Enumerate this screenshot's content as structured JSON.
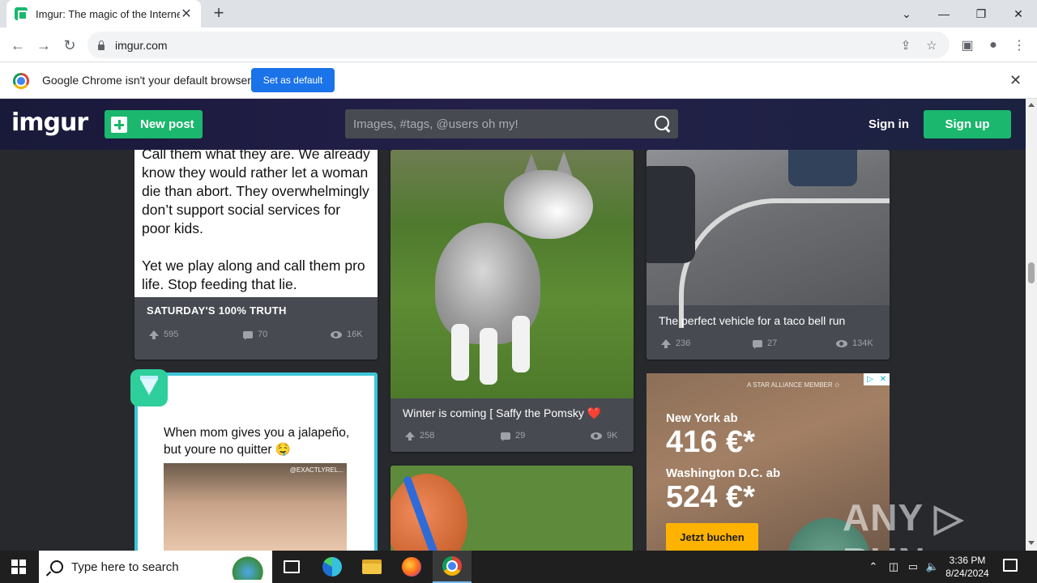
{
  "browser": {
    "tab": {
      "title": "Imgur: The magic of the Internet",
      "close": "✕"
    },
    "new_tab": "+",
    "window_controls": {
      "minimize": "—",
      "restore": "❐",
      "close": "✕",
      "menu": "⌄"
    },
    "address": "imgur.com",
    "infobar": {
      "message": "Google Chrome isn't your default browser",
      "button": "Set as default",
      "close": "✕"
    }
  },
  "imgur": {
    "logo": "imgur",
    "new_post": "New post",
    "search_placeholder": "Images, #tags, @users oh my!",
    "sign_in": "Sign in",
    "sign_up": "Sign up",
    "posts": [
      {
        "image_text": [
          "Call them what they are. We already know they would rather let a woman die than abort. They overwhelmingly don’t support social services for poor kids.",
          "Yet we play along and call them pro life. Stop feeding that lie."
        ],
        "title": "SATURDAY'S 100% TRUTH",
        "upvotes": "595",
        "comments": "70",
        "views": "16K"
      },
      {
        "title": "Winter is coming [ Saffy the Pomsky ❤️",
        "upvotes": "258",
        "comments": "29",
        "views": "9K"
      },
      {
        "title": "The perfect vehicle for a taco bell run",
        "upvotes": "236",
        "comments": "27",
        "views": "134K"
      },
      {
        "image_text": "When mom gives you a jalapeño, but youre no quitter 🤤",
        "credit": "@EXACTLYREL..."
      }
    ],
    "ad": {
      "alliance": "A STAR ALLIANCE MEMBER ✩",
      "city1": "New York ab",
      "price1": "416 €*",
      "city2": "Washington D.C. ab",
      "price2": "524 €*",
      "cta": "Jetzt buchen",
      "adchoices": "▷",
      "adclose": "✕"
    }
  },
  "watermark": "ANY ▷ RUN",
  "taskbar": {
    "search_placeholder": "Type here to search",
    "time": "3:36 PM",
    "date": "8/24/2024"
  },
  "colors": {
    "imgur_green": "#1bb76e",
    "chrome_blue": "#1a73e8",
    "card_bg": "#474a51",
    "page_bg": "#27292d",
    "gem_border": "#3ec5d8"
  }
}
